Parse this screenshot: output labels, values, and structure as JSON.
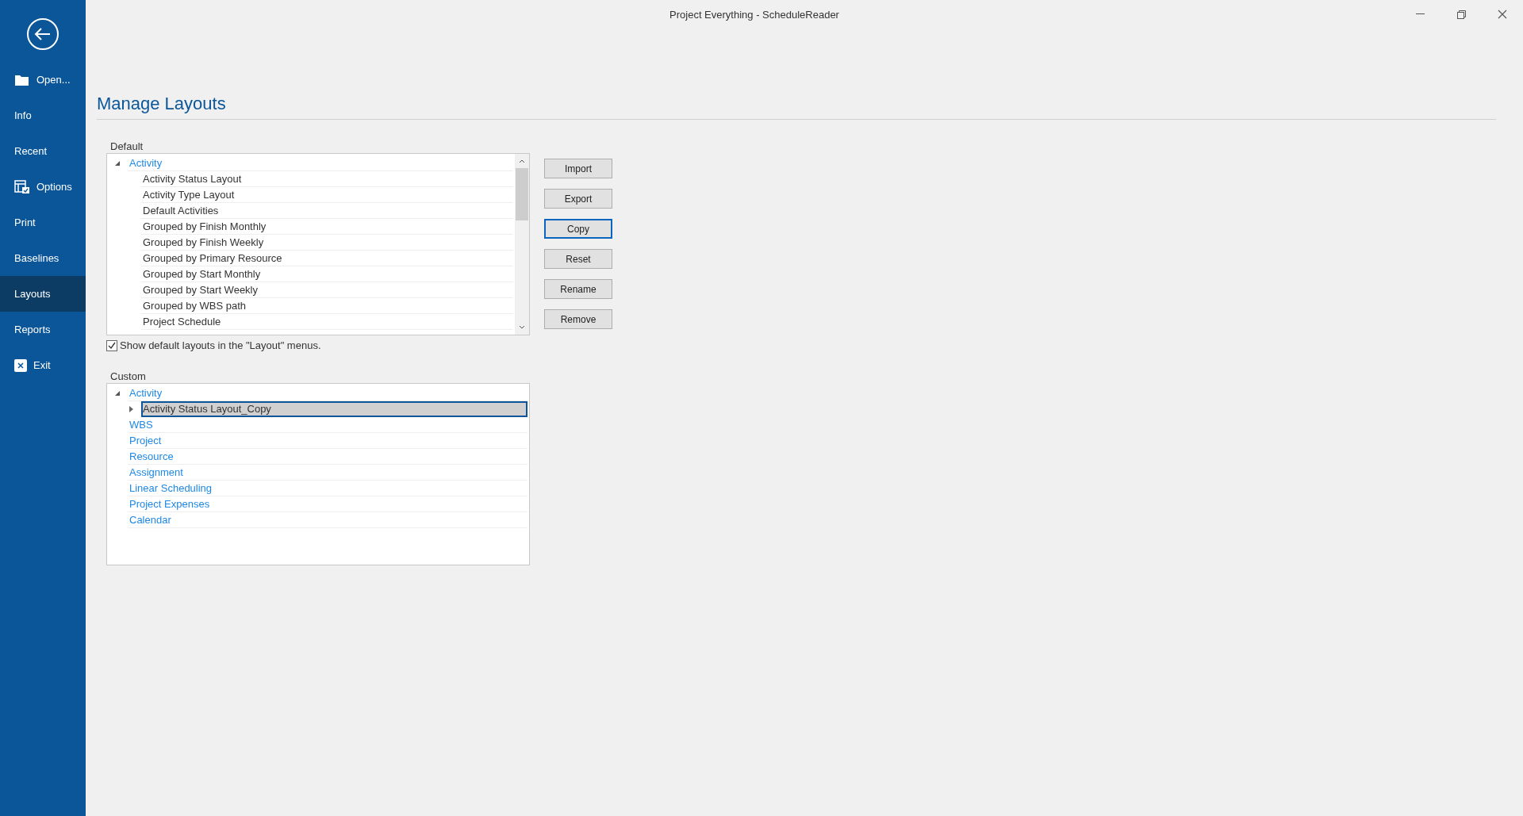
{
  "window": {
    "title": "Project Everything - ScheduleReader"
  },
  "sidebar": {
    "items": [
      {
        "label": "Open...",
        "kind": "folder",
        "selected": false
      },
      {
        "label": "Info",
        "kind": "plain",
        "selected": false
      },
      {
        "label": "Recent",
        "kind": "plain",
        "selected": false
      },
      {
        "label": "Options",
        "kind": "options",
        "selected": false
      },
      {
        "label": "Print",
        "kind": "plain",
        "selected": false
      },
      {
        "label": "Baselines",
        "kind": "plain",
        "selected": false
      },
      {
        "label": "Layouts",
        "kind": "plain",
        "selected": true
      },
      {
        "label": "Reports",
        "kind": "plain",
        "selected": false
      },
      {
        "label": "Exit",
        "kind": "exit",
        "selected": false
      }
    ]
  },
  "page_title": "Manage Layouts",
  "default_section": {
    "label": "Default",
    "tree": [
      {
        "label": "Activity",
        "expanded": true,
        "selected": false,
        "children": [
          {
            "label": "Activity Status Layout",
            "selected": false
          },
          {
            "label": "Activity Type Layout",
            "selected": false
          },
          {
            "label": "Default Activities",
            "selected": false
          },
          {
            "label": "Grouped by Finish Monthly",
            "selected": false
          },
          {
            "label": "Grouped by Finish Weekly",
            "selected": false
          },
          {
            "label": "Grouped by Primary Resource",
            "selected": false
          },
          {
            "label": "Grouped by Start Monthly",
            "selected": false
          },
          {
            "label": "Grouped by Start Weekly",
            "selected": false
          },
          {
            "label": "Grouped by WBS path",
            "selected": false
          },
          {
            "label": "Project Schedule",
            "selected": false
          }
        ]
      }
    ]
  },
  "show_defaults": {
    "label": "Show default layouts in the \"Layout\" menus.",
    "checked": true
  },
  "custom_section": {
    "label": "Custom",
    "tree": [
      {
        "label": "Activity",
        "expanded": true,
        "selected": false,
        "children": [
          {
            "label": "Activity Status Layout_Copy",
            "expanded": false,
            "selected": true
          }
        ]
      },
      {
        "label": "WBS",
        "selected": false
      },
      {
        "label": "Project",
        "selected": false
      },
      {
        "label": "Resource",
        "selected": false
      },
      {
        "label": "Assignment",
        "selected": false
      },
      {
        "label": "Linear Scheduling",
        "selected": false
      },
      {
        "label": "Project Expenses",
        "selected": false
      },
      {
        "label": "Calendar",
        "selected": false
      }
    ]
  },
  "buttons": [
    {
      "label": "Import",
      "focused": false
    },
    {
      "label": "Export",
      "focused": false
    },
    {
      "label": "Copy",
      "focused": true
    },
    {
      "label": "Reset",
      "focused": false
    },
    {
      "label": "Rename",
      "focused": false
    },
    {
      "label": "Remove",
      "focused": false
    }
  ]
}
